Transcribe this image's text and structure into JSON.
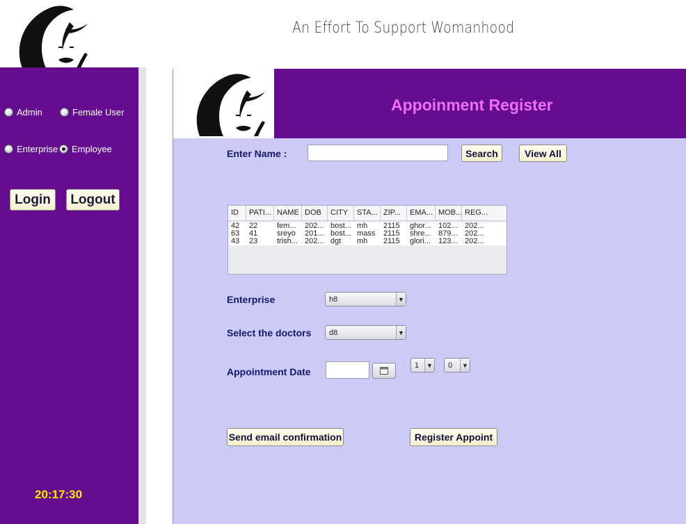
{
  "header": {
    "tagline": "An Effort To Support Womanhood"
  },
  "sidebar": {
    "roles": [
      {
        "label": "Admin",
        "checked": false
      },
      {
        "label": "Female User",
        "checked": false
      },
      {
        "label": "Enterprise",
        "checked": false
      },
      {
        "label": "Employee",
        "checked": true
      }
    ],
    "login_label": "Login",
    "logout_label": "Logout",
    "clock": "20:17:30"
  },
  "panel": {
    "title": "Appoinment Register",
    "search": {
      "label": "Enter Name :",
      "value": "",
      "search_label": "Search",
      "view_all_label": "View All"
    },
    "table": {
      "columns": [
        "ID",
        "PATI...",
        "NAME",
        "DOB",
        "CITY",
        "STA...",
        "ZIP...",
        "EMA...",
        "MOB...",
        "REG..."
      ],
      "rows": [
        [
          "42",
          "22",
          "fem...",
          "202...",
          "bost...",
          "mh",
          "2115",
          "ghor...",
          "102...",
          "202..."
        ],
        [
          "63",
          "41",
          "sreyo",
          "201...",
          "bost...",
          "mass",
          "2115",
          "shre...",
          "879...",
          "202..."
        ],
        [
          "43",
          "23",
          "trish...",
          "202...",
          "dgt",
          "mh",
          "2115",
          "glori...",
          "123...",
          "202..."
        ]
      ]
    },
    "enterprise": {
      "label": "Enterprise",
      "value": "h8"
    },
    "doctor": {
      "label": "Select the doctors",
      "value": "d8"
    },
    "appointment": {
      "label": "Appointment Date",
      "date_value": "",
      "hour": "1",
      "minute": "0"
    },
    "send_email_label": "Send email confirmation",
    "register_label": "Register Appoint"
  },
  "colors": {
    "brand_purple": "#640d8f",
    "panel_bg": "#cccbf7",
    "title_pink": "#ee6ff2",
    "clock_yellow": "#ffea00"
  }
}
